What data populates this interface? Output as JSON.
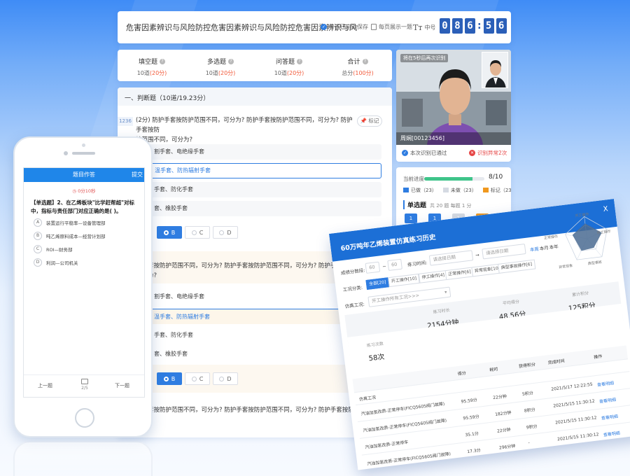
{
  "exam": {
    "title": "危害因素辨识与风险防控危害因素辨识与风险防控危害因素辨识与风",
    "autosave": "答卷已自动保存",
    "per_page": "每页展示一题",
    "font_size": "中号",
    "timer": [
      "0",
      "8",
      "6",
      "5",
      "6"
    ],
    "summary": [
      {
        "label": "填空题",
        "count": "10道",
        "score": "(20分)"
      },
      {
        "label": "多选题",
        "count": "10道",
        "score": "(20分)"
      },
      {
        "label": "问答题",
        "count": "10道",
        "score": "(20分)"
      },
      {
        "label": "合计",
        "count": "总分",
        "score": "(100分)"
      }
    ],
    "section_heading": "一、判断题（10道/19.23分）",
    "question_id": "1236",
    "q1_line1": "(2分) 防护手套按防护范围不同，可分为? 防护手套按防护范围不同，可分为? 防护手套按防",
    "q1_line2": "护范围不同，可分为?",
    "mark_label": "标记",
    "q1_options": [
      "割手套、电绝缘手套",
      "温手套、防热辐射手套",
      "手套、防化手套",
      "套、橡胶手套"
    ],
    "answer_options": [
      "B",
      "C",
      "D"
    ],
    "q2_line1": "护手套按防护范围不同，可分为? 防护手套按防护范围不同，可分为? 防护手套按防",
    "q2_line2": "可分为?",
    "q2_options": [
      "割手套、电绝缘手套",
      "温手套、防热辐射手套",
      "手套、防化手套",
      "套、橡胶手套"
    ],
    "q3_line1": "护手套按防护范围不同，可分为? 防护手套按防护范围不同，可分为? 防护手套按防"
  },
  "camera": {
    "note": "将在5秒后再次识别",
    "name": "周娴[00123456]",
    "verified": "本次识别已通过",
    "abnormal": "识别异常2次"
  },
  "progress": {
    "label": "当前进度",
    "count": "8/10",
    "fraction": 0.8,
    "legend": [
      "已做（23）",
      "未做（23）",
      "标记（23）"
    ],
    "section": "单选题",
    "section_meta": "共 20 题  每题 1 分",
    "cells": [
      "1",
      "1",
      "1",
      "1",
      "1",
      "1",
      "1",
      "1",
      "1",
      "1",
      "1",
      "1",
      "1",
      "1",
      "1"
    ],
    "cell_states": [
      "done",
      "done",
      "todo",
      "mark",
      "mark",
      "done",
      "done",
      "todo",
      "mark",
      "mark",
      "done",
      "done",
      "todo",
      "mark",
      "mark"
    ]
  },
  "colors": {
    "done": "#2f7de1",
    "todo": "#d5dae2",
    "mark": "#f0981e",
    "accent": "#2f7de1"
  },
  "phone": {
    "header": "题目作答",
    "submit": "提交",
    "timer": "0分10秒",
    "question": "【单选题】2、在乙烯板块\"比学赶帮超\"对标中，指标与责任部门对应正确的是(  )。",
    "options": [
      {
        "key": "A",
        "text": "装置运行平稳率—设备管理部"
      },
      {
        "key": "B",
        "text": "吨乙烯原料成本—经营计划部"
      },
      {
        "key": "C",
        "text": "ROI—财务部"
      },
      {
        "key": "D",
        "text": "利润—公司机关"
      }
    ],
    "prev": "上一题",
    "page": "2/5",
    "next": "下一题"
  },
  "stats": {
    "title": "60万吨年乙烯装置仿真练习历史",
    "close": "X",
    "score_label": "成绩分数段:",
    "score_from": "60",
    "score_to": "60",
    "time_label": "练习时间:",
    "start_ph": "请选择日期",
    "end_ph": "请选择日期",
    "periods": [
      "本周",
      "本月",
      "本年"
    ],
    "cat_label": "工况分类:",
    "categories": [
      "全部[20]",
      "开工操作[10]",
      "停工操作[4]",
      "正常操作[6]",
      "异常现象[10]",
      "典型事故操作[6]"
    ],
    "sim_label": "仿真工况:",
    "sim_value": "开工操作所有工况>>>",
    "radar_labels": [
      "开工操作",
      "停工操作",
      "典型事故",
      "异常现象",
      "正常操作"
    ],
    "row1": [
      {
        "label": "练习时长",
        "value": "2154分钟"
      },
      {
        "label": "平均得分",
        "value": "48.56分"
      },
      {
        "label": "累计积分",
        "value": "125积分"
      }
    ],
    "row2": [
      {
        "label": "练习次数",
        "value": "58次"
      }
    ],
    "columns": [
      "得分",
      "耗时",
      "获得积分",
      "完成时间",
      "操作"
    ],
    "section": "仿真工况",
    "rows": [
      {
        "name": "汽油加氢改质-正常停车(FICQ5605阀门故障)",
        "score": "95.59分",
        "time": "22分钟",
        "points": "5积分",
        "date": "2021/5/17 12:22:55",
        "op": "查看明细"
      },
      {
        "name": "汽油加氢改质-正常停车(FICQ5605阀门故障)",
        "score": "95.59分",
        "time": "182分钟",
        "points": "8积分",
        "date": "2021/5/15 11:30:12",
        "op": "查看明细"
      },
      {
        "name": "汽油加氢改质-正常停车",
        "score": "35.1分",
        "time": "22分钟",
        "points": "9积分",
        "date": "2021/5/15 11:30:12",
        "op": "查看明细"
      },
      {
        "name": "汽油加氢改质-正常停车(FICQ5605阀门故障)",
        "score": "17.3分",
        "time": "296分钟",
        "points": "-",
        "date": "2021/5/15 11:30:12",
        "op": "查看明细"
      }
    ]
  }
}
